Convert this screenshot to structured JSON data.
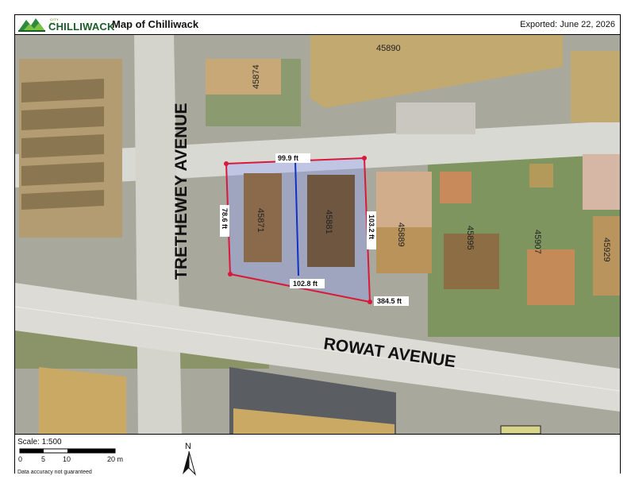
{
  "header": {
    "logo_city_of": "CITY OF",
    "logo_name": "CHILLIWACK",
    "title": "Map of Chilliwack",
    "exported": "Exported: June 22, 2026"
  },
  "map": {
    "streets": {
      "trethewey": "TRETHEWEY AVENUE",
      "rowat": "ROWAT AVENUE"
    },
    "parcels": {
      "p45890": "45890",
      "p45874": "45874",
      "p45871": "45871",
      "p45881": "45881",
      "p45889": "45889",
      "p45895": "45895",
      "p45907": "45907",
      "p45929": "45929"
    },
    "measurements": {
      "top": "99.9 ft",
      "left": "78.6 ft",
      "right": "103.2 ft",
      "bottom": "102.8 ft",
      "total": "384.5 ft"
    },
    "colors": {
      "parcel_outline": "#d9183b",
      "divider_line": "#1030c8",
      "selection_fill": "#8fa0ff"
    }
  },
  "footer": {
    "scale": "Scale: 1:500",
    "scale_ticks": [
      "0",
      "5",
      "10",
      "20 m"
    ],
    "disclaimer": "Data accuracy not guaranteed",
    "north": "N"
  }
}
